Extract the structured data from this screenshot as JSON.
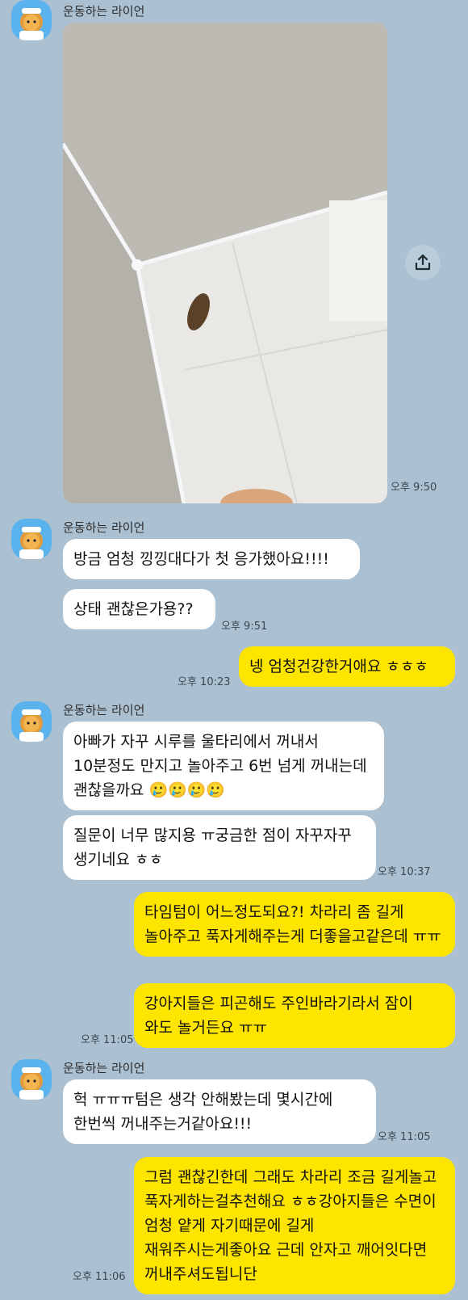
{
  "sender_name": "운동하는 라이언",
  "colors": {
    "background": "#abc1d1",
    "incoming": "#ffffff",
    "outgoing": "#fee500"
  },
  "photo": {
    "alt": "사진"
  },
  "messages": {
    "t1": "오후 9:50",
    "m1": "방금 엄청 낑낑대다가 첫 응가했아요!!!!",
    "m2": "상태 괜찮은가용??",
    "t2": "오후 9:51",
    "o1": "넹 엄청건강한거애요 ㅎㅎㅎ",
    "t3": "오후 10:23",
    "m3": "아빠가 자꾸 시루를 울타리에서 꺼내서 10분정도 만지고 놀아주고 6번 넘게 꺼내는데 괜찮을까요 🥲🥲🥲🥲",
    "m4": "질문이 너무 많지용 ㅠ궁금한 점이 자꾸자꾸 생기네요 ㅎㅎ",
    "t4": "오후 10:37",
    "o2": "타임텀이 어느정도되요?! 차라리 좀 길게 놀아주고 푹자게해주는게 더좋을고같은데 ㅠㅠ",
    "o3": "강아지들은 피곤해도 주인바라기라서 잠이 와도 놀거든요 ㅠㅠ",
    "t5": "오후 11:05",
    "m5": "헉 ㅠㅠㅠ텀은 생각 안해봤는데 몇시간에 한번씩 꺼내주는거같아요!!!",
    "t6": "오후 11:05",
    "o4": "그럼 괜찮긴한데 그래도 차라리 조금 길게놀고 푹자게하는걸추천해요 ㅎㅎ강아지들은 수면이 엄청 얕게 자기때문에 길게 재워주시는게좋아요 근데 안자고 깨어잇다면 꺼내주셔도됩니단",
    "t7": "오후 11:06"
  }
}
